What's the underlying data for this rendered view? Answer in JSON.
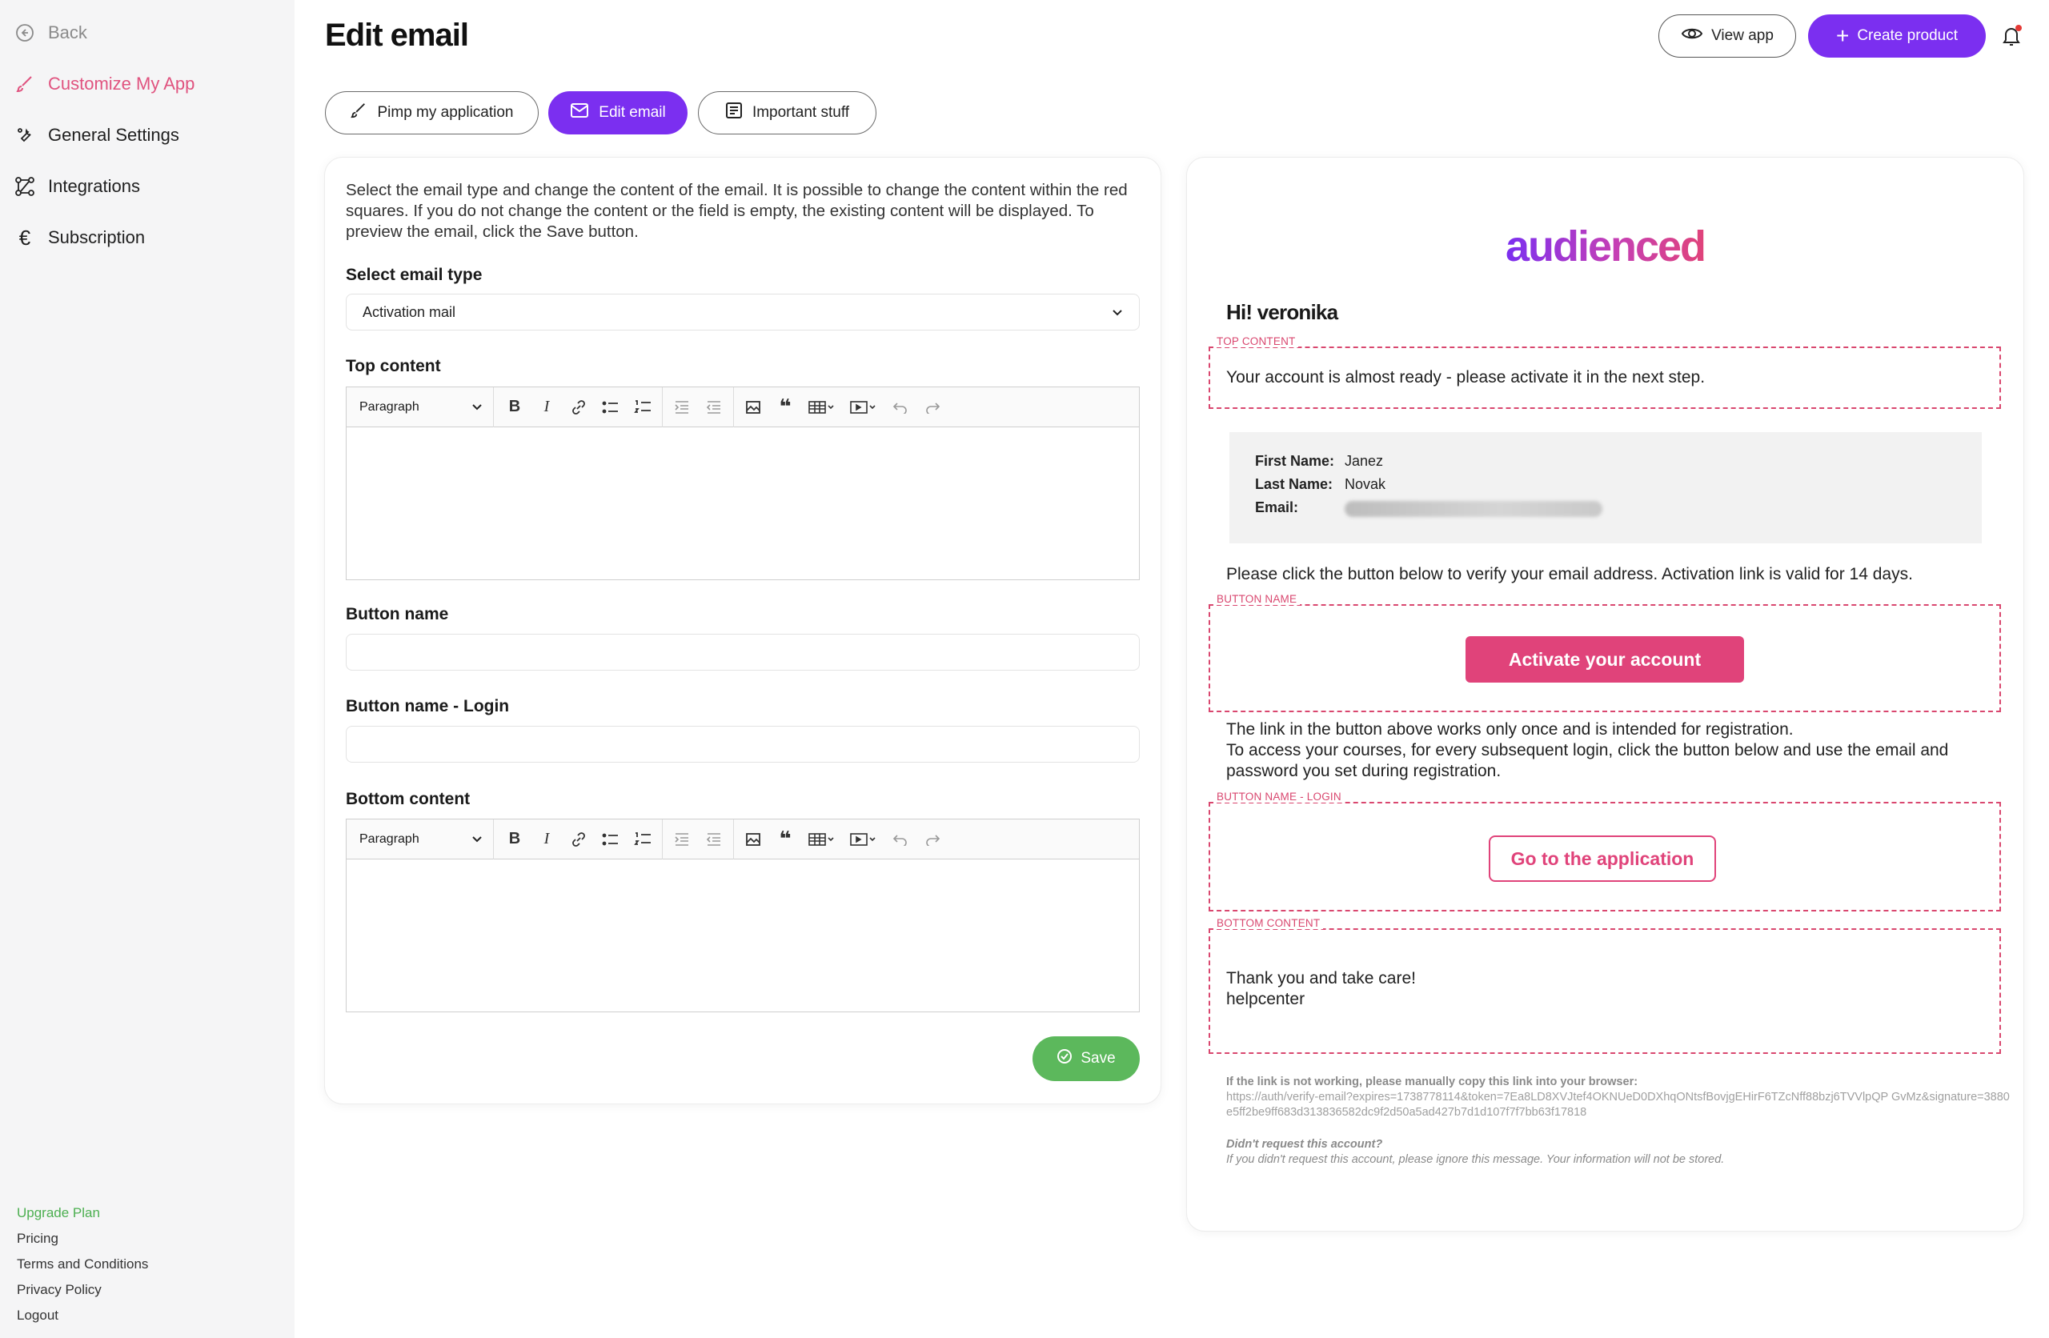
{
  "sidebar": {
    "back": "Back",
    "items": [
      {
        "label": "Customize My App",
        "icon": "brush-icon",
        "active": true
      },
      {
        "label": "General Settings",
        "icon": "wrench-icon"
      },
      {
        "label": "Integrations",
        "icon": "integrations-icon"
      },
      {
        "label": "Subscription",
        "icon": "euro-icon"
      }
    ],
    "footer": {
      "upgrade": "Upgrade Plan",
      "pricing": "Pricing",
      "terms": "Terms and Conditions",
      "privacy": "Privacy Policy",
      "logout": "Logout"
    }
  },
  "header": {
    "title": "Edit email",
    "view_app": "View app",
    "create_product": "Create product"
  },
  "tabs": [
    {
      "label": "Pimp my application"
    },
    {
      "label": "Edit email",
      "active": true
    },
    {
      "label": "Important stuff"
    }
  ],
  "form": {
    "intro": "Select the email type and change the content of the email. It is possible to change the content within the red squares. If you do not change the content or the field is empty, the existing content will be displayed. To preview the email, click the Save button.",
    "email_type_label": "Select email type",
    "email_type_value": "Activation mail",
    "top_content_label": "Top content",
    "button_name_label": "Button name",
    "button_name_value": "",
    "button_login_label": "Button name - Login",
    "button_login_value": "",
    "bottom_content_label": "Bottom content",
    "toolbar_paragraph": "Paragraph",
    "save": "Save"
  },
  "preview": {
    "logo": "audienced",
    "greeting": "Hi! veronika",
    "top_tag": "TOP CONTENT",
    "top_text": "Your account is almost ready - please activate it in the next step.",
    "first_name_label": "First Name:",
    "first_name": "Janez",
    "last_name_label": "Last Name:",
    "last_name": "Novak",
    "email_label": "Email:",
    "verify_text_1": "Please click the button below to verify your email address. Activation link is valid for ",
    "verify_days": "14 days.",
    "button_tag": "BUTTON NAME",
    "activate_button": "Activate your account",
    "once_text": "The link in the button above works only once and is intended for registration.",
    "access_bold": "To access your courses, for every subsequent login, click the button below",
    "access_rest": " and use the email and password you set during registration.",
    "login_tag": "BUTTON NAME - LOGIN",
    "goto_button": "Go to the application",
    "bottom_tag": "BOTTOM CONTENT",
    "bottom_line1": "Thank you and take care!",
    "bottom_line2": "helpcenter",
    "link_note": "If the link is not working, please manually copy this link into your browser:",
    "link_url": "https://auth/verify-email?expires=1738778114&token=7Ea8LD8XVJtef4OKNUeD0DXhqONtsfBovjgEHirF6TZcNff88bzj6TVVlpQP GvMz&signature=3880e5ff2be9ff683d313836582dc9f2d50a5ad427b7d1d107f7f7bb63f17818",
    "didnt_request": "Didn't request this account?",
    "ignore_note": "If you didn't request this account, please ignore this message. Your information will not be stored."
  },
  "colors": {
    "accent_purple": "#7b2ff0",
    "accent_pink": "#e0437a",
    "save_green": "#5cb85c",
    "upgrade_green": "#4caf50"
  }
}
